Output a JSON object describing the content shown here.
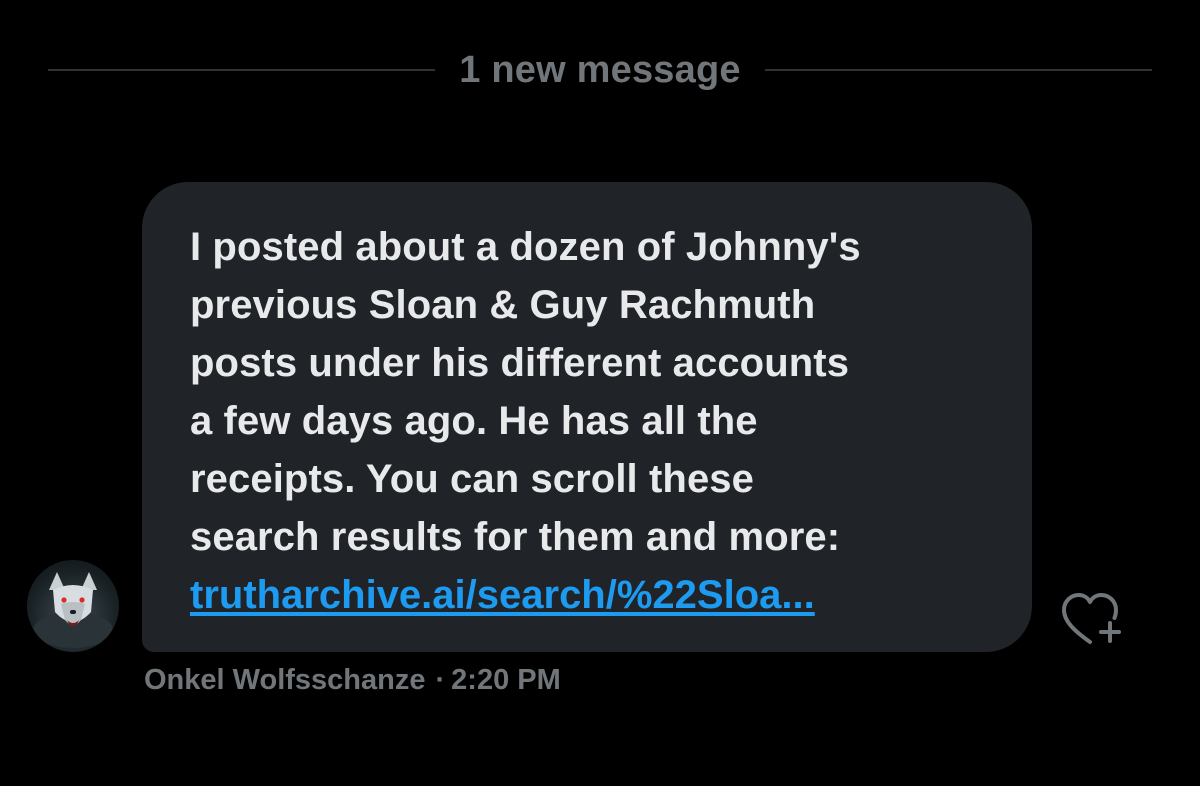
{
  "divider": {
    "label": "1 new message"
  },
  "message": {
    "lines": [
      "I posted about a dozen of Johnny's",
      "previous Sloan & Guy Rachmuth",
      "posts under his different accounts",
      "a few days ago. He has all the",
      "receipts. You can scroll these",
      "search results for them and more:"
    ],
    "link_text": "trutharchive.ai/search/%22Sloa..."
  },
  "sender": {
    "name": "Onkel Wolfsschanze",
    "separator": "·",
    "time": "2:20 PM",
    "avatar_icon": "wolf-avatar-icon"
  },
  "actions": {
    "react_icon": "heart-plus-icon"
  },
  "colors": {
    "background": "#000000",
    "bubble": "#202327",
    "text": "#e7e9ea",
    "muted": "#71767b",
    "link": "#1d9bf0"
  }
}
